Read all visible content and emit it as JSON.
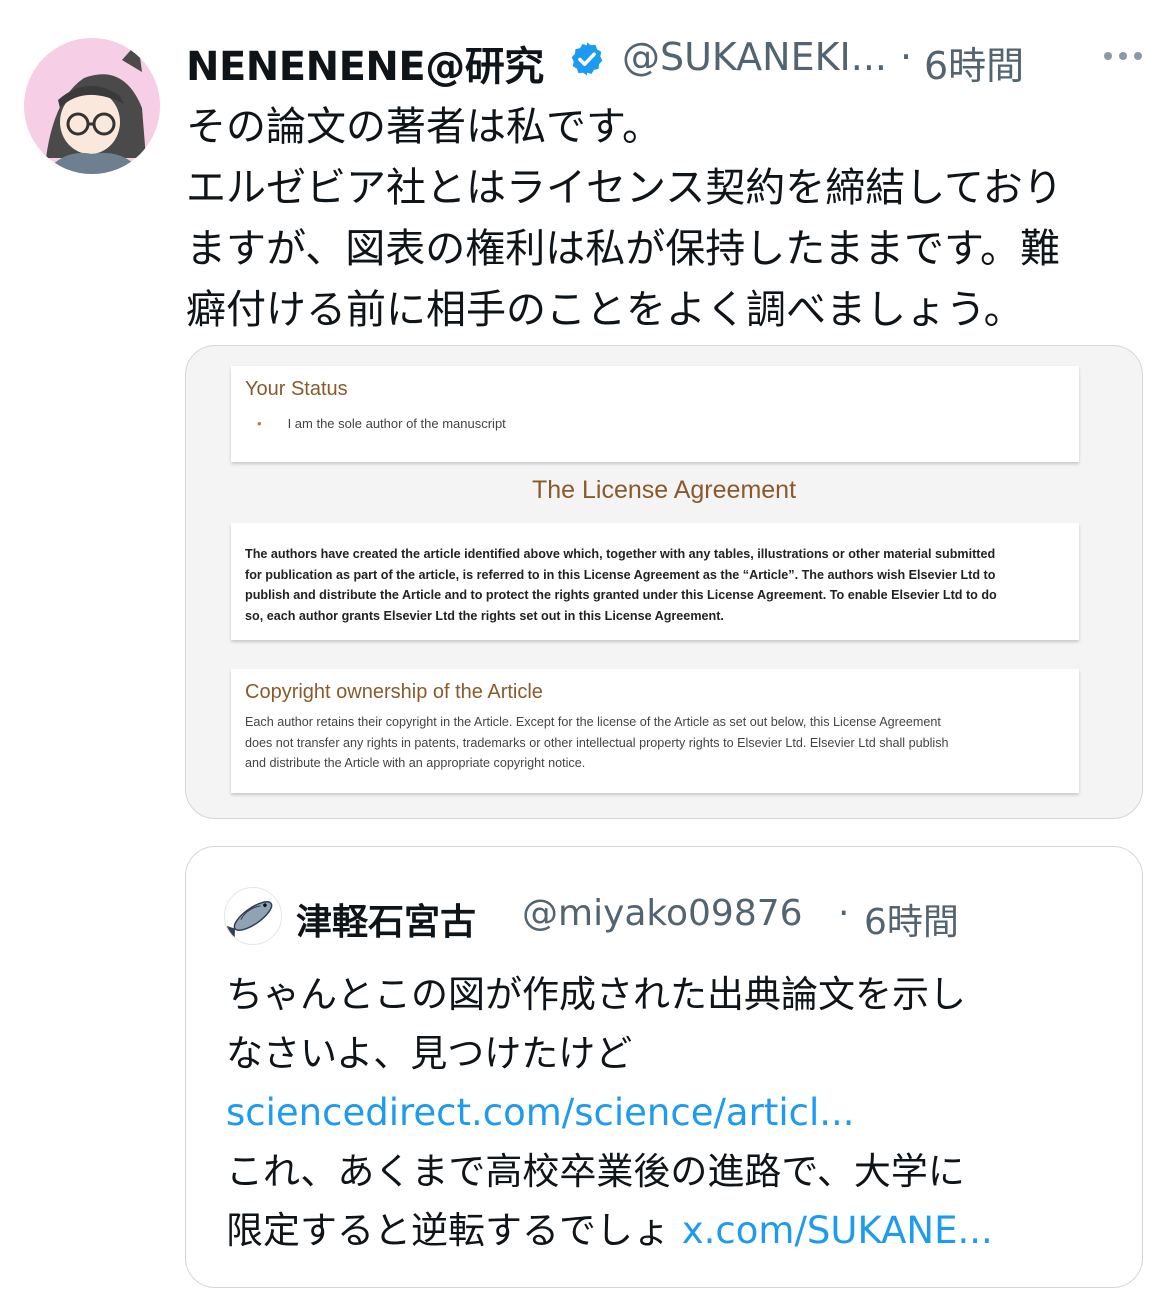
{
  "tweet": {
    "display_name": "NENENENE@研究",
    "handle": "@SUKANEKI...",
    "separator": "·",
    "time": "6時間",
    "icons": {
      "verified": "verified-badge-icon",
      "more": "more-options-icon"
    },
    "text_lines": [
      "その論文の著者は私です。",
      "エルゼビア社とはライセンス契約を締結しており",
      "ますが、図表の権利は私が保持したままです。難",
      "癖付ける前に相手のことをよく調べましょう。"
    ]
  },
  "media": {
    "status_heading": "Your Status",
    "status_bullet": "•",
    "status_item": "I am the sole author of the manuscript",
    "license_title": "The License Agreement",
    "license_lines": [
      "The authors have created the article identified above which, together with any tables, illustrations or other material submitted",
      "for publication as part of the article, is referred to in this License Agreement as the “Article”. The authors wish Elsevier Ltd to",
      "publish and distribute the Article and to protect the rights granted under this License Agreement. To enable Elsevier Ltd to do",
      "so, each author grants Elsevier Ltd the rights set out in this License Agreement."
    ],
    "copyright_heading": "Copyright ownership of the Article",
    "copyright_lines": [
      "Each author retains their copyright in the Article. Except for the license of the Article as set out below, this License Agreement",
      "does not transfer any rights in patents, trademarks or other intellectual property rights to Elsevier Ltd. Elsevier Ltd shall publish",
      "and distribute the Article with an appropriate copyright notice."
    ]
  },
  "quote": {
    "display_name": "津軽石宮古",
    "handle": "@miyako09876",
    "separator": "·",
    "time": "6時間",
    "line1": "ちゃんとこの図が作成された出典論文を示し",
    "line2": "なさいよ、見つけたけど",
    "link1": "sciencedirect.com/science/articl...",
    "line4": "これ、あくまで高校卒業後の進路で、大学に",
    "line5": "限定すると逆転するでしょ",
    "link2": "x.com/SUKANE..."
  },
  "colors": {
    "text": "#0f1419",
    "secondary": "#536471",
    "link": "#1d9bf0",
    "verified": "#1d9bf0",
    "doc_heading": "#8a5a2b",
    "avatar_bg": "#f6cfe6"
  }
}
